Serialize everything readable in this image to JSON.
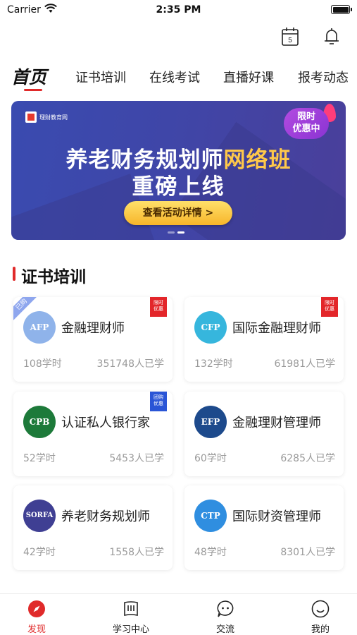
{
  "status_bar": {
    "carrier": "Carrier",
    "time": "2:35 PM"
  },
  "header": {
    "calendar_day": "5"
  },
  "tabs": [
    {
      "label": "首页",
      "active": true
    },
    {
      "label": "证书培训"
    },
    {
      "label": "在线考试"
    },
    {
      "label": "直播好课"
    },
    {
      "label": "报考动态"
    }
  ],
  "banner": {
    "logo_text": "理财教育网",
    "badge": [
      "限时",
      "优惠中"
    ],
    "title_main": "养老财务规划师",
    "title_highlight": "网络班",
    "subtitle": "重磅上线",
    "cta": "查看活动详情 >"
  },
  "section": {
    "title": "证书培训"
  },
  "courses": [
    {
      "badge": "AFP",
      "name": "金融理财师",
      "hours": "108学时",
      "learners": "351748人已学",
      "tag": [
        "限时",
        "优惠"
      ],
      "tag_color": "#e3262a",
      "corner": "已购",
      "circle_color": "#8fb3ea"
    },
    {
      "badge": "CFP",
      "name": "国际金融理财师",
      "hours": "132学时",
      "learners": "61981人已学",
      "tag": [
        "限时",
        "优惠"
      ],
      "tag_color": "#e3262a",
      "circle_color": "#36b6dd"
    },
    {
      "badge": "CPB",
      "name": "认证私人银行家",
      "hours": "52学时",
      "learners": "5453人已学",
      "tag": [
        "团购",
        "优惠"
      ],
      "tag_color": "#2a55d6",
      "circle_color": "#1d7a3a"
    },
    {
      "badge": "EFP",
      "name": "金融理财管理师",
      "hours": "60学时",
      "learners": "6285人已学",
      "circle_color": "#1d4a8c"
    },
    {
      "badge": "SORFA",
      "name": "养老财务规划师",
      "hours": "42学时",
      "learners": "1558人已学",
      "circle_color": "#3f3f93"
    },
    {
      "badge": "CTP",
      "name": "国际财资管理师",
      "hours": "48学时",
      "learners": "8301人已学",
      "circle_color": "#2f8ee0"
    }
  ],
  "bottom_nav": [
    {
      "label": "发现",
      "icon": "compass-icon",
      "active": true
    },
    {
      "label": "学习中心",
      "icon": "book-icon"
    },
    {
      "label": "交流",
      "icon": "chat-icon"
    },
    {
      "label": "我的",
      "icon": "smile-icon"
    }
  ],
  "colors": {
    "accent": "#e02a2a",
    "banner": "#3f46a8",
    "cta": "#f7b52a"
  }
}
